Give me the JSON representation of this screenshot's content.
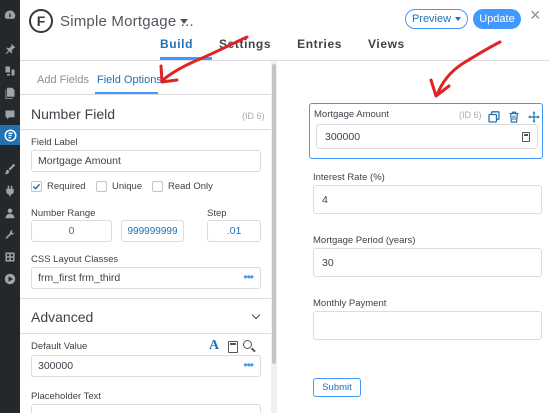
{
  "header": {
    "form_title": "Simple Mortgage ...",
    "preview_label": "Preview",
    "update_label": "Update",
    "close_glyph": "×",
    "tabs": [
      {
        "label": "Build",
        "active": true
      },
      {
        "label": "Settings",
        "active": false
      },
      {
        "label": "Entries",
        "active": false
      },
      {
        "label": "Views",
        "active": false
      }
    ],
    "accent_color": "#4199fd"
  },
  "sidebar": {
    "subtabs": [
      {
        "label": "Add Fields",
        "active": false
      },
      {
        "label": "Field Options",
        "active": true
      }
    ],
    "field_type_title": "Number Field",
    "field_id": "(ID 6)",
    "field_label_label": "Field Label",
    "field_label_value": "Mortgage Amount",
    "checkboxes": [
      {
        "label": "Required",
        "checked": true
      },
      {
        "label": "Unique",
        "checked": false
      },
      {
        "label": "Read Only",
        "checked": false
      }
    ],
    "number_range_label": "Number Range",
    "range_min": "0",
    "range_max": "999999999",
    "step_label": "Step",
    "step_value": ".01",
    "css_label": "CSS Layout Classes",
    "css_value": "frm_first frm_third",
    "dots_glyph": "•••",
    "advanced_title": "Advanced",
    "default_value_label": "Default Value",
    "default_value": "300000",
    "text_tool_glyph": "A",
    "placeholder_label": "Placeholder Text"
  },
  "preview": {
    "fields": [
      {
        "label": "Mortgage Amount",
        "value": "300000",
        "selected": true,
        "id": "(ID 6)"
      },
      {
        "label": "Interest Rate (%)",
        "value": "4"
      },
      {
        "label": "Mortgage Period (years)",
        "value": "30"
      },
      {
        "label": "Monthly Payment",
        "value": ""
      }
    ],
    "submit_label": "Submit"
  },
  "wp_menu_icons": [
    "dashboard-icon",
    "posts-icon",
    "media-icon",
    "pages-icon",
    "comments-icon",
    "formidable-icon",
    "appearance-icon",
    "plugins-icon",
    "users-icon",
    "tools-icon",
    "settings-icon",
    "play-icon"
  ],
  "annotation_color": "#e02424"
}
